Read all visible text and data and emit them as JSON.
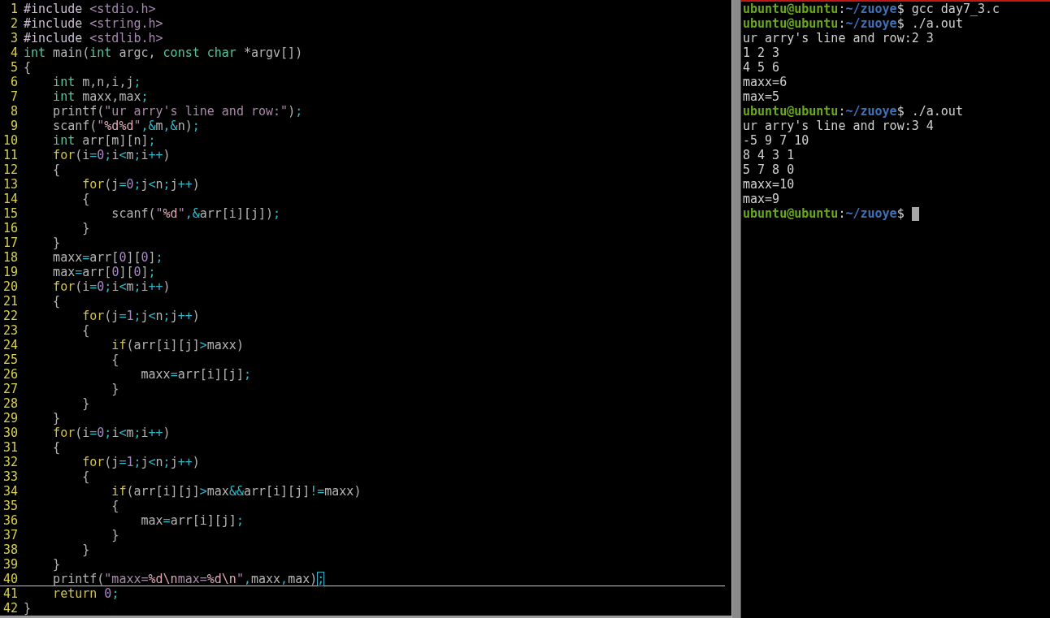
{
  "editor": {
    "lines": [
      {
        "number": "1",
        "current": false,
        "cursor_at_end": false,
        "tokens": [
          {
            "kind": "preproc",
            "text": "#include"
          },
          {
            "kind": "header",
            "text": " <stdio.h>"
          }
        ]
      },
      {
        "number": "2",
        "current": false,
        "cursor_at_end": false,
        "tokens": [
          {
            "kind": "preproc",
            "text": "#include"
          },
          {
            "kind": "header",
            "text": " <string.h>"
          }
        ]
      },
      {
        "number": "3",
        "current": false,
        "cursor_at_end": false,
        "tokens": [
          {
            "kind": "preproc",
            "text": "#include"
          },
          {
            "kind": "header",
            "text": " <stdlib.h>"
          }
        ]
      },
      {
        "number": "4",
        "current": false,
        "cursor_at_end": false,
        "tokens": [
          {
            "kind": "type",
            "text": "int"
          },
          {
            "kind": "plain",
            "text": " main("
          },
          {
            "kind": "type",
            "text": "int"
          },
          {
            "kind": "plain",
            "text": " argc, "
          },
          {
            "kind": "type",
            "text": "const"
          },
          {
            "kind": "type",
            "text": " char"
          },
          {
            "kind": "plain",
            "text": " *argv[])"
          }
        ]
      },
      {
        "number": "5",
        "current": false,
        "cursor_at_end": false,
        "tokens": [
          {
            "kind": "plain",
            "text": "{"
          }
        ]
      },
      {
        "number": "6",
        "current": false,
        "cursor_at_end": false,
        "tokens": [
          {
            "kind": "type",
            "text": "    int"
          },
          {
            "kind": "plain",
            "text": " m,n,i,j"
          },
          {
            "kind": "op",
            "text": ";"
          }
        ]
      },
      {
        "number": "7",
        "current": false,
        "cursor_at_end": false,
        "tokens": [
          {
            "kind": "type",
            "text": "    int"
          },
          {
            "kind": "plain",
            "text": " maxx,max"
          },
          {
            "kind": "op",
            "text": ";"
          }
        ]
      },
      {
        "number": "8",
        "current": false,
        "cursor_at_end": false,
        "tokens": [
          {
            "kind": "plain",
            "text": "    printf("
          },
          {
            "kind": "string",
            "text": "\"ur arry's line and row:\""
          },
          {
            "kind": "plain",
            "text": ")"
          },
          {
            "kind": "op",
            "text": ";"
          }
        ]
      },
      {
        "number": "9",
        "current": false,
        "cursor_at_end": false,
        "tokens": [
          {
            "kind": "plain",
            "text": "    scanf("
          },
          {
            "kind": "string",
            "text": "\""
          },
          {
            "kind": "format",
            "text": "%d%d"
          },
          {
            "kind": "string",
            "text": "\""
          },
          {
            "kind": "op",
            "text": ",&"
          },
          {
            "kind": "plain",
            "text": "m"
          },
          {
            "kind": "op",
            "text": ",&"
          },
          {
            "kind": "plain",
            "text": "n)"
          },
          {
            "kind": "op",
            "text": ";"
          }
        ]
      },
      {
        "number": "10",
        "current": false,
        "cursor_at_end": false,
        "tokens": [
          {
            "kind": "type",
            "text": "    int"
          },
          {
            "kind": "plain",
            "text": " arr[m][n]"
          },
          {
            "kind": "op",
            "text": ";"
          }
        ]
      },
      {
        "number": "11",
        "current": false,
        "cursor_at_end": false,
        "tokens": [
          {
            "kind": "keyword",
            "text": "    for"
          },
          {
            "kind": "plain",
            "text": "(i"
          },
          {
            "kind": "op",
            "text": "="
          },
          {
            "kind": "number",
            "text": "0"
          },
          {
            "kind": "op",
            "text": ";"
          },
          {
            "kind": "plain",
            "text": "i"
          },
          {
            "kind": "op",
            "text": "<"
          },
          {
            "kind": "plain",
            "text": "m"
          },
          {
            "kind": "op",
            "text": ";"
          },
          {
            "kind": "plain",
            "text": "i"
          },
          {
            "kind": "op",
            "text": "++"
          },
          {
            "kind": "plain",
            "text": ")"
          }
        ]
      },
      {
        "number": "12",
        "current": false,
        "cursor_at_end": false,
        "tokens": [
          {
            "kind": "plain",
            "text": "    {"
          }
        ]
      },
      {
        "number": "13",
        "current": false,
        "cursor_at_end": false,
        "tokens": [
          {
            "kind": "keyword",
            "text": "        for"
          },
          {
            "kind": "plain",
            "text": "(j"
          },
          {
            "kind": "op",
            "text": "="
          },
          {
            "kind": "number",
            "text": "0"
          },
          {
            "kind": "op",
            "text": ";"
          },
          {
            "kind": "plain",
            "text": "j"
          },
          {
            "kind": "op",
            "text": "<"
          },
          {
            "kind": "plain",
            "text": "n"
          },
          {
            "kind": "op",
            "text": ";"
          },
          {
            "kind": "plain",
            "text": "j"
          },
          {
            "kind": "op",
            "text": "++"
          },
          {
            "kind": "plain",
            "text": ")"
          }
        ]
      },
      {
        "number": "14",
        "current": false,
        "cursor_at_end": false,
        "tokens": [
          {
            "kind": "plain",
            "text": "        {"
          }
        ]
      },
      {
        "number": "15",
        "current": false,
        "cursor_at_end": false,
        "tokens": [
          {
            "kind": "plain",
            "text": "            scanf("
          },
          {
            "kind": "string",
            "text": "\""
          },
          {
            "kind": "format",
            "text": "%d"
          },
          {
            "kind": "string",
            "text": "\""
          },
          {
            "kind": "op",
            "text": ",&"
          },
          {
            "kind": "plain",
            "text": "arr[i][j])"
          },
          {
            "kind": "op",
            "text": ";"
          }
        ]
      },
      {
        "number": "16",
        "current": false,
        "cursor_at_end": false,
        "tokens": [
          {
            "kind": "plain",
            "text": "        }"
          }
        ]
      },
      {
        "number": "17",
        "current": false,
        "cursor_at_end": false,
        "tokens": [
          {
            "kind": "plain",
            "text": "    }"
          }
        ]
      },
      {
        "number": "18",
        "current": false,
        "cursor_at_end": false,
        "tokens": [
          {
            "kind": "plain",
            "text": "    maxx"
          },
          {
            "kind": "op",
            "text": "="
          },
          {
            "kind": "plain",
            "text": "arr["
          },
          {
            "kind": "number",
            "text": "0"
          },
          {
            "kind": "plain",
            "text": "]["
          },
          {
            "kind": "number",
            "text": "0"
          },
          {
            "kind": "plain",
            "text": "]"
          },
          {
            "kind": "op",
            "text": ";"
          }
        ]
      },
      {
        "number": "19",
        "current": false,
        "cursor_at_end": false,
        "tokens": [
          {
            "kind": "plain",
            "text": "    max"
          },
          {
            "kind": "op",
            "text": "="
          },
          {
            "kind": "plain",
            "text": "arr["
          },
          {
            "kind": "number",
            "text": "0"
          },
          {
            "kind": "plain",
            "text": "]["
          },
          {
            "kind": "number",
            "text": "0"
          },
          {
            "kind": "plain",
            "text": "]"
          },
          {
            "kind": "op",
            "text": ";"
          }
        ]
      },
      {
        "number": "20",
        "current": false,
        "cursor_at_end": false,
        "tokens": [
          {
            "kind": "keyword",
            "text": "    for"
          },
          {
            "kind": "plain",
            "text": "(i"
          },
          {
            "kind": "op",
            "text": "="
          },
          {
            "kind": "number",
            "text": "0"
          },
          {
            "kind": "op",
            "text": ";"
          },
          {
            "kind": "plain",
            "text": "i"
          },
          {
            "kind": "op",
            "text": "<"
          },
          {
            "kind": "plain",
            "text": "m"
          },
          {
            "kind": "op",
            "text": ";"
          },
          {
            "kind": "plain",
            "text": "i"
          },
          {
            "kind": "op",
            "text": "++"
          },
          {
            "kind": "plain",
            "text": ")"
          }
        ]
      },
      {
        "number": "21",
        "current": false,
        "cursor_at_end": false,
        "tokens": [
          {
            "kind": "plain",
            "text": "    {"
          }
        ]
      },
      {
        "number": "22",
        "current": false,
        "cursor_at_end": false,
        "tokens": [
          {
            "kind": "keyword",
            "text": "        for"
          },
          {
            "kind": "plain",
            "text": "(j"
          },
          {
            "kind": "op",
            "text": "="
          },
          {
            "kind": "number",
            "text": "1"
          },
          {
            "kind": "op",
            "text": ";"
          },
          {
            "kind": "plain",
            "text": "j"
          },
          {
            "kind": "op",
            "text": "<"
          },
          {
            "kind": "plain",
            "text": "n"
          },
          {
            "kind": "op",
            "text": ";"
          },
          {
            "kind": "plain",
            "text": "j"
          },
          {
            "kind": "op",
            "text": "++"
          },
          {
            "kind": "plain",
            "text": ")"
          }
        ]
      },
      {
        "number": "23",
        "current": false,
        "cursor_at_end": false,
        "tokens": [
          {
            "kind": "plain",
            "text": "        {"
          }
        ]
      },
      {
        "number": "24",
        "current": false,
        "cursor_at_end": false,
        "tokens": [
          {
            "kind": "keyword",
            "text": "            if"
          },
          {
            "kind": "plain",
            "text": "(arr[i][j]"
          },
          {
            "kind": "op",
            "text": ">"
          },
          {
            "kind": "plain",
            "text": "maxx)"
          }
        ]
      },
      {
        "number": "25",
        "current": false,
        "cursor_at_end": false,
        "tokens": [
          {
            "kind": "plain",
            "text": "            {"
          }
        ]
      },
      {
        "number": "26",
        "current": false,
        "cursor_at_end": false,
        "tokens": [
          {
            "kind": "plain",
            "text": "                maxx"
          },
          {
            "kind": "op",
            "text": "="
          },
          {
            "kind": "plain",
            "text": "arr[i][j]"
          },
          {
            "kind": "op",
            "text": ";"
          }
        ]
      },
      {
        "number": "27",
        "current": false,
        "cursor_at_end": false,
        "tokens": [
          {
            "kind": "plain",
            "text": "            }"
          }
        ]
      },
      {
        "number": "28",
        "current": false,
        "cursor_at_end": false,
        "tokens": [
          {
            "kind": "plain",
            "text": "        }"
          }
        ]
      },
      {
        "number": "29",
        "current": false,
        "cursor_at_end": false,
        "tokens": [
          {
            "kind": "plain",
            "text": "    }"
          }
        ]
      },
      {
        "number": "30",
        "current": false,
        "cursor_at_end": false,
        "tokens": [
          {
            "kind": "keyword",
            "text": "    for"
          },
          {
            "kind": "plain",
            "text": "(i"
          },
          {
            "kind": "op",
            "text": "="
          },
          {
            "kind": "number",
            "text": "0"
          },
          {
            "kind": "op",
            "text": ";"
          },
          {
            "kind": "plain",
            "text": "i"
          },
          {
            "kind": "op",
            "text": "<"
          },
          {
            "kind": "plain",
            "text": "m"
          },
          {
            "kind": "op",
            "text": ";"
          },
          {
            "kind": "plain",
            "text": "i"
          },
          {
            "kind": "op",
            "text": "++"
          },
          {
            "kind": "plain",
            "text": ")"
          }
        ]
      },
      {
        "number": "31",
        "current": false,
        "cursor_at_end": false,
        "tokens": [
          {
            "kind": "plain",
            "text": "    {"
          }
        ]
      },
      {
        "number": "32",
        "current": false,
        "cursor_at_end": false,
        "tokens": [
          {
            "kind": "keyword",
            "text": "        for"
          },
          {
            "kind": "plain",
            "text": "(j"
          },
          {
            "kind": "op",
            "text": "="
          },
          {
            "kind": "number",
            "text": "1"
          },
          {
            "kind": "op",
            "text": ";"
          },
          {
            "kind": "plain",
            "text": "j"
          },
          {
            "kind": "op",
            "text": "<"
          },
          {
            "kind": "plain",
            "text": "n"
          },
          {
            "kind": "op",
            "text": ";"
          },
          {
            "kind": "plain",
            "text": "j"
          },
          {
            "kind": "op",
            "text": "++"
          },
          {
            "kind": "plain",
            "text": ")"
          }
        ]
      },
      {
        "number": "33",
        "current": false,
        "cursor_at_end": false,
        "tokens": [
          {
            "kind": "plain",
            "text": "        {"
          }
        ]
      },
      {
        "number": "34",
        "current": false,
        "cursor_at_end": false,
        "tokens": [
          {
            "kind": "keyword",
            "text": "            if"
          },
          {
            "kind": "plain",
            "text": "(arr[i][j]"
          },
          {
            "kind": "op",
            "text": ">"
          },
          {
            "kind": "plain",
            "text": "max"
          },
          {
            "kind": "op",
            "text": "&&"
          },
          {
            "kind": "plain",
            "text": "arr[i][j]"
          },
          {
            "kind": "op",
            "text": "!="
          },
          {
            "kind": "plain",
            "text": "maxx)"
          }
        ]
      },
      {
        "number": "35",
        "current": false,
        "cursor_at_end": false,
        "tokens": [
          {
            "kind": "plain",
            "text": "            {"
          }
        ]
      },
      {
        "number": "36",
        "current": false,
        "cursor_at_end": false,
        "tokens": [
          {
            "kind": "plain",
            "text": "                max"
          },
          {
            "kind": "op",
            "text": "="
          },
          {
            "kind": "plain",
            "text": "arr[i][j]"
          },
          {
            "kind": "op",
            "text": ";"
          }
        ]
      },
      {
        "number": "37",
        "current": false,
        "cursor_at_end": false,
        "tokens": [
          {
            "kind": "plain",
            "text": "            }"
          }
        ]
      },
      {
        "number": "38",
        "current": false,
        "cursor_at_end": false,
        "tokens": [
          {
            "kind": "plain",
            "text": "        }"
          }
        ]
      },
      {
        "number": "39",
        "current": false,
        "cursor_at_end": false,
        "tokens": [
          {
            "kind": "plain",
            "text": "    }"
          }
        ]
      },
      {
        "number": "40",
        "current": true,
        "cursor_at_end": true,
        "tokens": [
          {
            "kind": "plain",
            "text": "    printf("
          },
          {
            "kind": "string",
            "text": "\"maxx="
          },
          {
            "kind": "format",
            "text": "%d\\n"
          },
          {
            "kind": "string",
            "text": "max="
          },
          {
            "kind": "format",
            "text": "%d\\n"
          },
          {
            "kind": "string",
            "text": "\""
          },
          {
            "kind": "op",
            "text": ","
          },
          {
            "kind": "plain",
            "text": "maxx"
          },
          {
            "kind": "op",
            "text": ","
          },
          {
            "kind": "plain",
            "text": "max)"
          },
          {
            "kind": "op",
            "text": ";"
          }
        ]
      },
      {
        "number": "41",
        "current": false,
        "cursor_at_end": false,
        "tokens": [
          {
            "kind": "keyword",
            "text": "    return"
          },
          {
            "kind": "number",
            "text": " 0"
          },
          {
            "kind": "op",
            "text": ";"
          }
        ]
      },
      {
        "number": "42",
        "current": false,
        "cursor_at_end": false,
        "tokens": [
          {
            "kind": "plain",
            "text": "}"
          }
        ]
      }
    ]
  },
  "terminal": {
    "lines": [
      {
        "kind": "prompt",
        "user_host": "ubuntu@ubuntu",
        "separator": ":",
        "path": "~/zuoye",
        "symbol": "$",
        "command": "gcc day7_3.c",
        "cursor": false
      },
      {
        "kind": "prompt",
        "user_host": "ubuntu@ubuntu",
        "separator": ":",
        "path": "~/zuoye",
        "symbol": "$",
        "command": "./a.out",
        "cursor": false
      },
      {
        "kind": "output",
        "text": "ur arry's line and row:2 3"
      },
      {
        "kind": "output",
        "text": "1 2 3"
      },
      {
        "kind": "output",
        "text": "4 5 6"
      },
      {
        "kind": "output",
        "text": "maxx=6"
      },
      {
        "kind": "output",
        "text": "max=5"
      },
      {
        "kind": "prompt",
        "user_host": "ubuntu@ubuntu",
        "separator": ":",
        "path": "~/zuoye",
        "symbol": "$",
        "command": "./a.out",
        "cursor": false
      },
      {
        "kind": "output",
        "text": "ur arry's line and row:3 4"
      },
      {
        "kind": "output",
        "text": "-5 9 7 10"
      },
      {
        "kind": "output",
        "text": "8 4 3 1"
      },
      {
        "kind": "output",
        "text": "5 7 8 0"
      },
      {
        "kind": "output",
        "text": "maxx=10"
      },
      {
        "kind": "output",
        "text": "max=9"
      },
      {
        "kind": "prompt",
        "user_host": "ubuntu@ubuntu",
        "separator": ":",
        "path": "~/zuoye",
        "symbol": "$",
        "cursor": true
      }
    ]
  }
}
